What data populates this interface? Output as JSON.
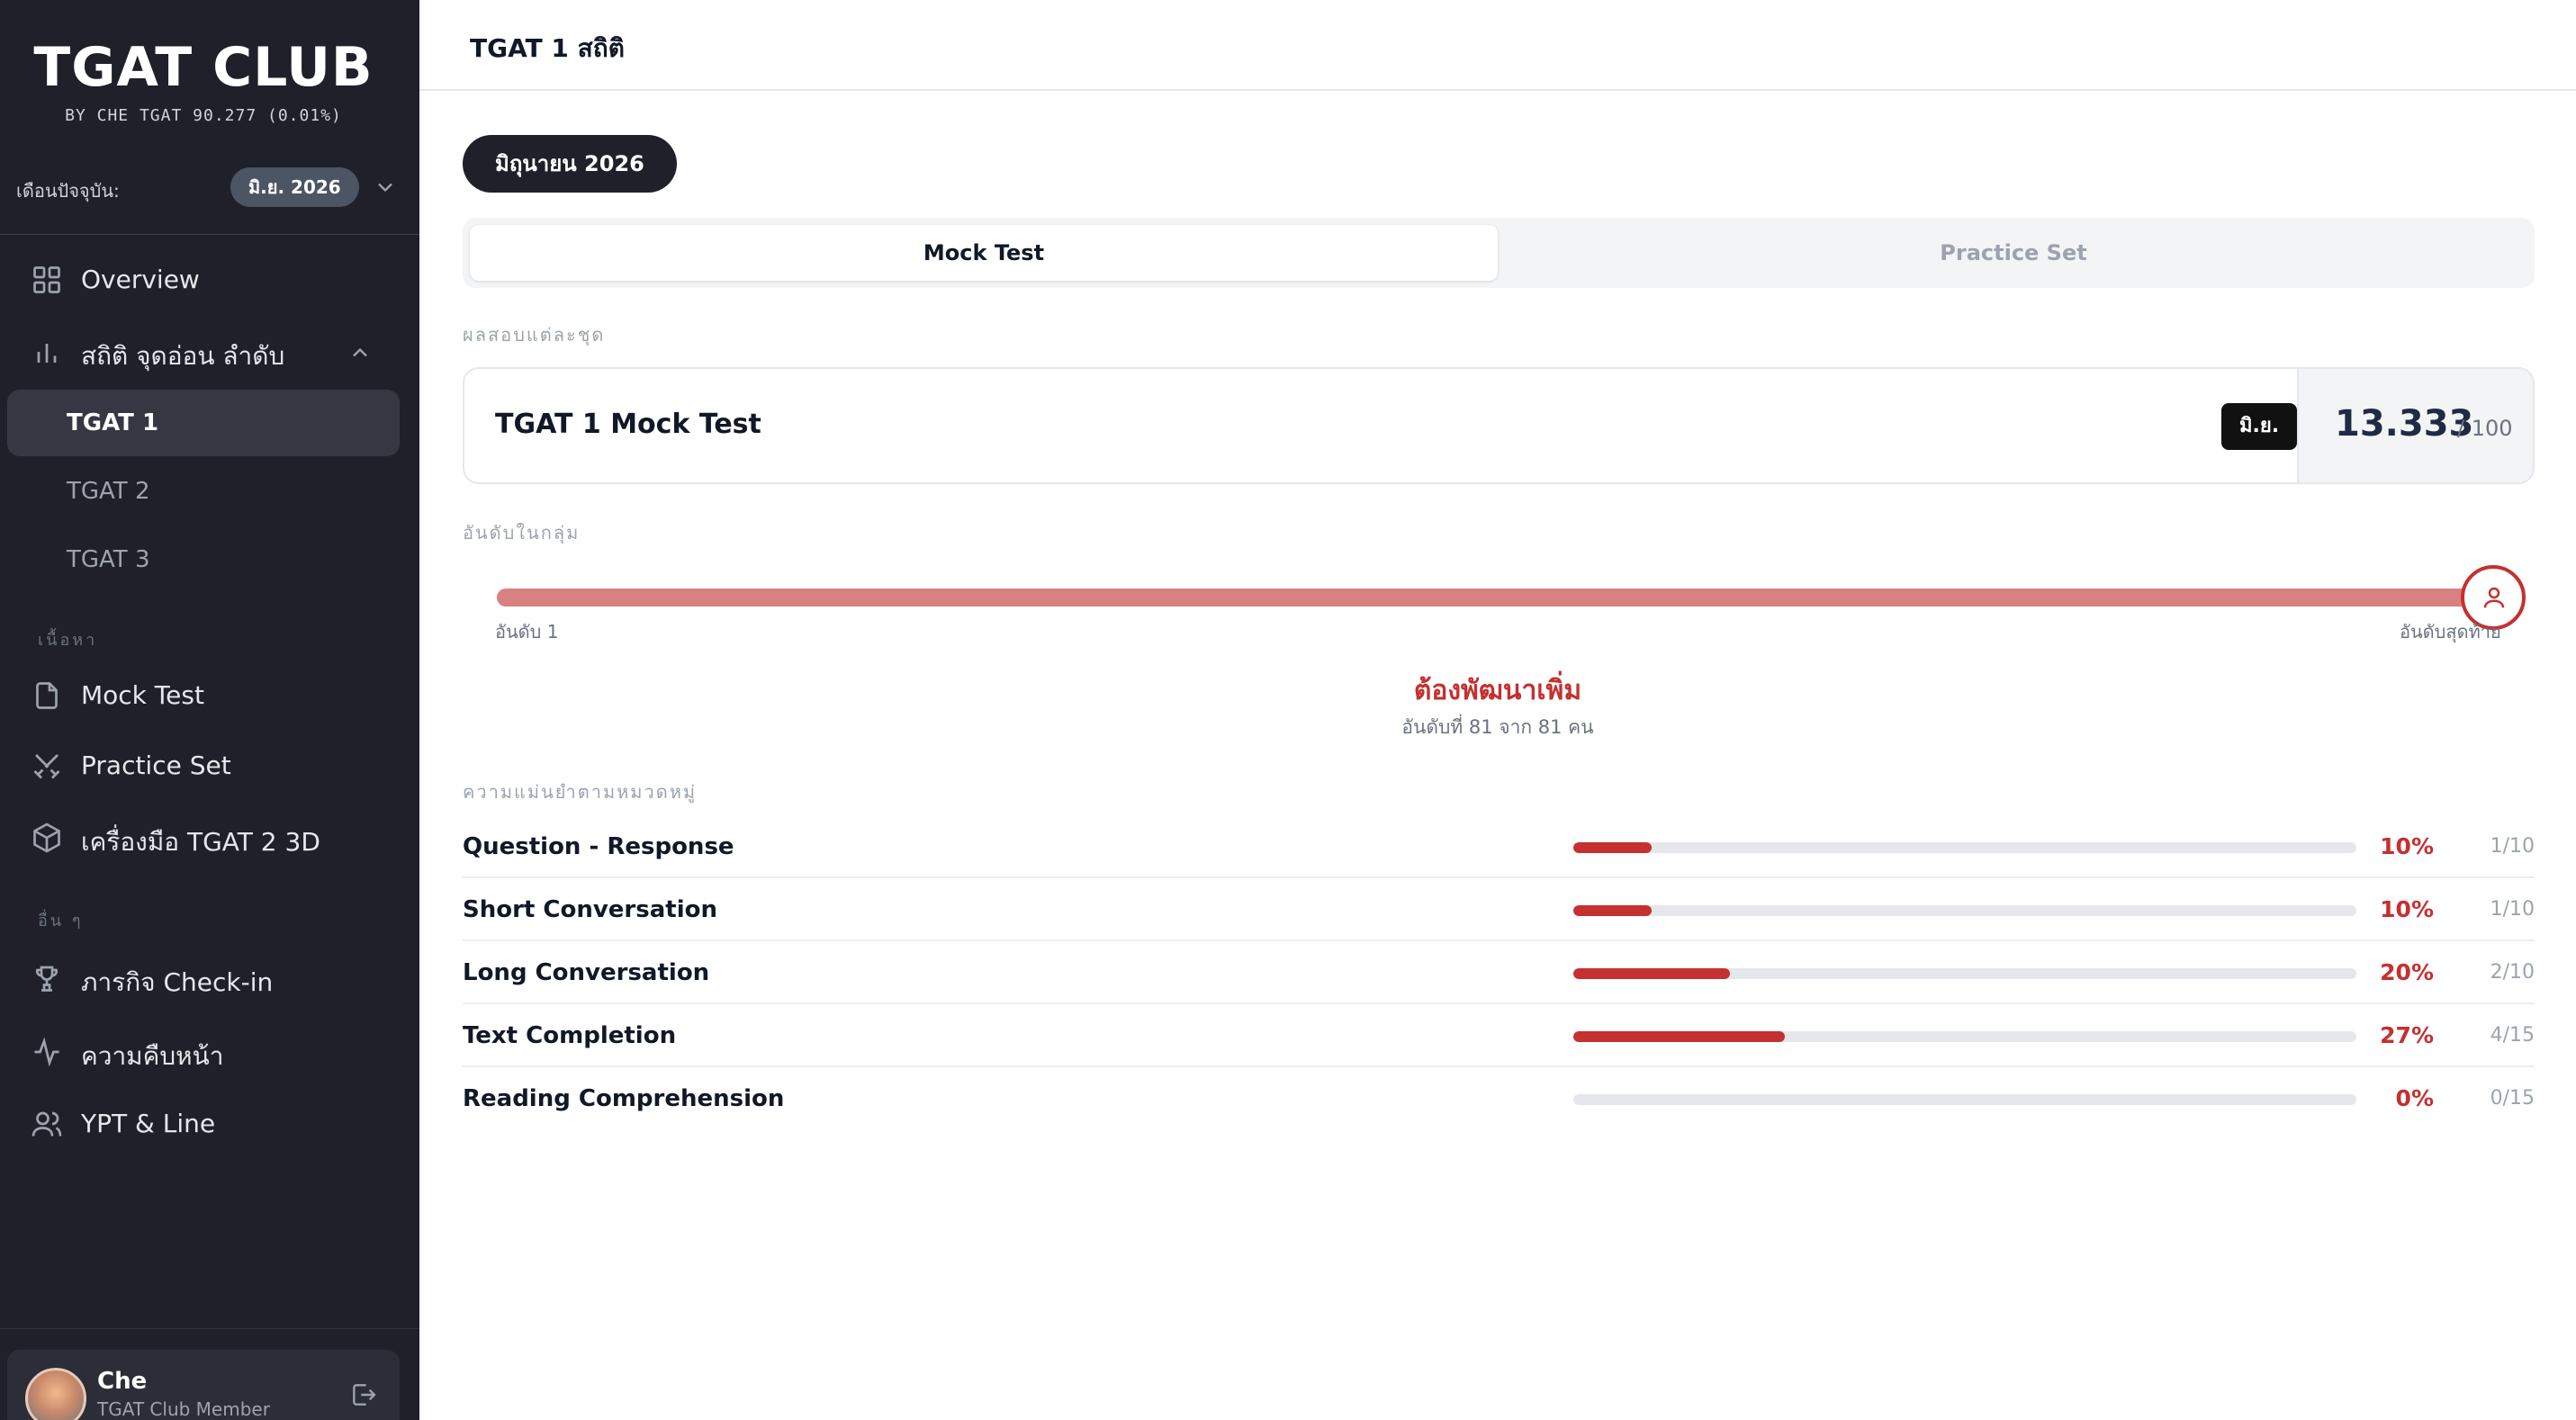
{
  "sidebar": {
    "brand": "TGAT CLUB",
    "brand_sub": "BY CHE TGAT 90.277 (0.01%)",
    "month_label": "เดือนปัจจุบัน:",
    "month_badge": "มิ.ย. 2026",
    "nav": {
      "overview": "Overview",
      "stats": "สถิติ จุดอ่อน ลำดับ",
      "tgat1": "TGAT 1",
      "tgat2": "TGAT 2",
      "tgat3": "TGAT 3",
      "section_content": "เนื้อหา",
      "mock_test": "Mock Test",
      "practice_set": "Practice Set",
      "tool_3d": "เครื่องมือ TGAT 2 3D",
      "section_other": "อื่น ๆ",
      "checkin": "ภารกิจ Check-in",
      "progress": "ความคืบหน้า",
      "ypt_line": "YPT & Line"
    },
    "user": {
      "name": "Che",
      "role": "TGAT Club Member"
    }
  },
  "header": {
    "title": "TGAT 1 สถิติ"
  },
  "main": {
    "month_pill": "มิถุนายน 2026",
    "tabs": {
      "mock": "Mock Test",
      "practice": "Practice Set"
    },
    "results_label": "ผลสอบแต่ละชุด",
    "result": {
      "name": "TGAT 1 Mock Test",
      "badge": "มิ.ย.",
      "score": "13.333",
      "max": "/ 100"
    },
    "rank": {
      "label": "อันดับในกลุ่ม",
      "start": "อันดับ 1",
      "end": "อันดับสุดท้าย",
      "status": "ต้องพัฒนาเพิ่ม",
      "detail": "อันดับที่ 81 จาก 81 คน",
      "position": 1.0
    },
    "accuracy_label": "ความแม่นยำตามหมวดหมู่",
    "categories": [
      {
        "name": "Question - Response",
        "pct": "10%",
        "count": "1/10",
        "fraction": 0.1
      },
      {
        "name": "Short Conversation",
        "pct": "10%",
        "count": "1/10",
        "fraction": 0.1
      },
      {
        "name": "Long Conversation",
        "pct": "20%",
        "count": "2/10",
        "fraction": 0.2
      },
      {
        "name": "Text Completion",
        "pct": "27%",
        "count": "4/15",
        "fraction": 0.27
      },
      {
        "name": "Reading Comprehension",
        "pct": "0%",
        "count": "0/15",
        "fraction": 0.0
      }
    ]
  },
  "colors": {
    "sidebar_bg": "#1f2029",
    "accent_red": "#c53030",
    "rank_track": "#d98080"
  }
}
